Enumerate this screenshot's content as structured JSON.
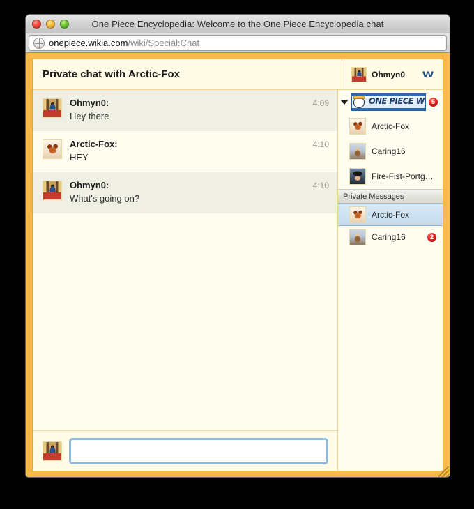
{
  "window": {
    "title": "One Piece Encyclopedia: Welcome to the One Piece Encyclopedia chat",
    "traffic_lights": [
      "close-button",
      "minimize-button",
      "zoom-button"
    ],
    "url_domain": "onepiece.wikia.com",
    "url_path": "/wiki/Special:Chat"
  },
  "chat": {
    "header_title": "Private chat with Arctic-Fox",
    "current_user": "Ohmyn0",
    "wikia_logo_text": "W",
    "messages": [
      {
        "author": "Ohmyn0:",
        "text": "Hey there",
        "time": "4:09",
        "avatar": "av-ohmyn0",
        "style": "alt"
      },
      {
        "author": "Arctic-Fox:",
        "text": "HEY",
        "time": "4:10",
        "avatar": "av-arctic",
        "style": "plain"
      },
      {
        "author": "Ohmyn0:",
        "text": "What's going on?",
        "time": "4:10",
        "avatar": "av-ohmyn0",
        "style": "alt"
      }
    ],
    "input_value": "",
    "input_placeholder": ""
  },
  "sidebar": {
    "wiki_name": "ONE PIECE WIKI",
    "wiki_badge": "5",
    "users": [
      {
        "name": "Arctic-Fox",
        "avatar": "av-arctic"
      },
      {
        "name": "Caring16",
        "avatar": "av-caring"
      },
      {
        "name": "Fire-Fist-Portgas…",
        "avatar": "av-firefist"
      }
    ],
    "private_messages_label": "Private Messages",
    "private_messages": [
      {
        "name": "Arctic-Fox",
        "avatar": "av-arctic",
        "badge": "",
        "selected": true
      },
      {
        "name": "Caring16",
        "avatar": "av-caring",
        "badge": "2",
        "selected": false
      }
    ]
  },
  "colors": {
    "frame_orange": "#f7b94b",
    "chat_bg": "#fffdf0",
    "alt_row": "#f0efe4",
    "badge_red": "#e01c18",
    "selected_blue": "#c3dcee",
    "wikia_blue": "#1a4f87"
  }
}
